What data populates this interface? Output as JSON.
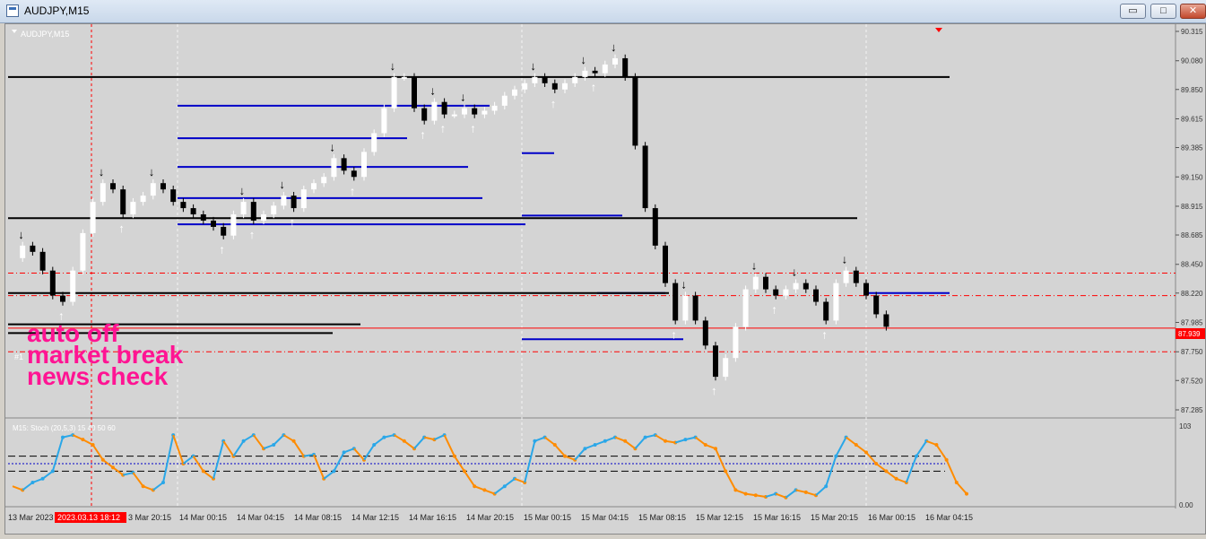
{
  "window": {
    "title": "AUDJPY,M15",
    "min": "▭",
    "max": "□",
    "close": "✕"
  },
  "chart_label": "AUDJPY,M15",
  "overlay_lines": [
    "auto off",
    "market break",
    "news check"
  ],
  "faint_labels": [
    "#1"
  ],
  "price_axis": [
    "90.315",
    "90.080",
    "89.850",
    "89.615",
    "89.385",
    "89.150",
    "88.915",
    "88.685",
    "88.450",
    "88.220",
    "87.985",
    "87.750",
    "87.520",
    "87.285"
  ],
  "current_price": "87.939",
  "stoch_label": "M15: Stoch (20,5,3) 15 40 50 60",
  "stoch_axis": {
    "top": "103",
    "bottom": "0.00"
  },
  "time_axis": [
    "13 Mar 2023",
    "14 Mar 00:15",
    "14 Mar 04:15",
    "14 Mar 08:15",
    "14 Mar 12:15",
    "14 Mar 16:15",
    "14 Mar 20:15",
    "15 Mar 00:15",
    "15 Mar 04:15",
    "15 Mar 08:15",
    "15 Mar 12:15",
    "15 Mar 16:15",
    "15 Mar 20:15",
    "16 Mar 00:15",
    "16 Mar 04:15"
  ],
  "time_partial": "3 Mar 20:15",
  "time_badge": "2023.03.13 18:12",
  "colors": {
    "bg": "#d4d4d4",
    "bull": "#ffffff",
    "bear": "#000000",
    "level": "#000000",
    "zone": "#0000c8",
    "overlay": "#ff1493",
    "redline": "#ff0000",
    "stoch_up": "#2aa7e8",
    "stoch_down": "#ff8c00",
    "badge": "#ff0000"
  },
  "chart_data": {
    "type": "line",
    "ylim": [
      87.285,
      90.315
    ],
    "x": [
      0,
      10,
      20,
      30,
      40,
      50,
      60,
      70,
      80,
      90,
      100,
      110,
      120,
      130,
      140,
      150,
      160,
      170,
      180,
      190,
      200,
      210,
      220,
      230,
      240,
      250,
      260,
      270,
      280,
      290,
      300,
      310,
      320,
      330,
      340,
      350,
      360,
      370,
      380,
      390,
      400,
      410,
      420,
      430,
      440,
      450,
      460,
      470,
      480,
      490,
      500,
      510,
      520,
      530,
      540,
      550,
      560,
      570,
      580,
      590,
      600,
      610,
      620,
      630,
      640,
      650,
      660,
      670,
      680,
      690,
      700,
      710,
      720,
      730,
      740,
      750,
      760,
      770,
      780,
      790,
      800,
      810,
      820,
      830,
      840,
      850,
      860,
      870,
      880,
      890,
      900,
      910,
      920,
      930,
      940,
      950,
      960,
      970,
      980,
      990,
      1000,
      1010,
      1020,
      1030,
      1040
    ],
    "price": [
      88.5,
      88.6,
      88.55,
      88.4,
      88.2,
      88.15,
      88.4,
      88.7,
      88.95,
      89.1,
      89.05,
      88.85,
      88.95,
      89.0,
      89.1,
      89.05,
      88.95,
      88.9,
      88.85,
      88.8,
      88.75,
      88.68,
      88.85,
      88.95,
      88.8,
      88.85,
      88.92,
      89.0,
      88.9,
      89.05,
      89.1,
      89.15,
      89.3,
      89.2,
      89.15,
      89.35,
      89.5,
      89.7,
      89.95,
      89.95,
      89.7,
      89.6,
      89.75,
      89.65,
      89.65,
      89.7,
      89.65,
      89.68,
      89.72,
      89.8,
      89.85,
      89.9,
      89.95,
      89.9,
      89.85,
      89.9,
      89.95,
      90.0,
      89.98,
      90.05,
      90.1,
      89.95,
      89.4,
      88.9,
      88.6,
      88.3,
      88.0,
      88.2,
      88.0,
      87.8,
      87.55,
      87.7,
      87.95,
      88.25,
      88.35,
      88.25,
      88.2,
      88.25,
      88.3,
      88.25,
      88.15,
      88.0,
      88.3,
      88.4,
      88.3,
      88.2,
      88.05,
      87.95
    ],
    "stoch": [
      20,
      15,
      25,
      30,
      40,
      85,
      88,
      82,
      75,
      55,
      45,
      35,
      38,
      20,
      15,
      25,
      88,
      50,
      60,
      40,
      30,
      80,
      60,
      80,
      88,
      70,
      75,
      88,
      80,
      60,
      62,
      30,
      40,
      65,
      70,
      55,
      75,
      85,
      88,
      80,
      70,
      85,
      82,
      88,
      60,
      40,
      20,
      15,
      10,
      20,
      30,
      25,
      80,
      85,
      75,
      60,
      55,
      70,
      75,
      80,
      85,
      80,
      70,
      85,
      88,
      80,
      78,
      82,
      85,
      75,
      70,
      40,
      15,
      10,
      8,
      6,
      10,
      5,
      15,
      12,
      8,
      20,
      60,
      85,
      75,
      65,
      50,
      40,
      30,
      25,
      60,
      80,
      75,
      55,
      25,
      10
    ],
    "levels": [
      89.95,
      88.82,
      88.22,
      87.97,
      87.9
    ],
    "blue_zones": [
      89.72,
      89.46,
      89.23,
      88.98,
      88.77,
      89.34,
      88.84,
      88.22,
      87.85
    ],
    "red_dash": [
      88.38,
      88.2,
      87.75
    ],
    "red_solid": 87.939
  }
}
